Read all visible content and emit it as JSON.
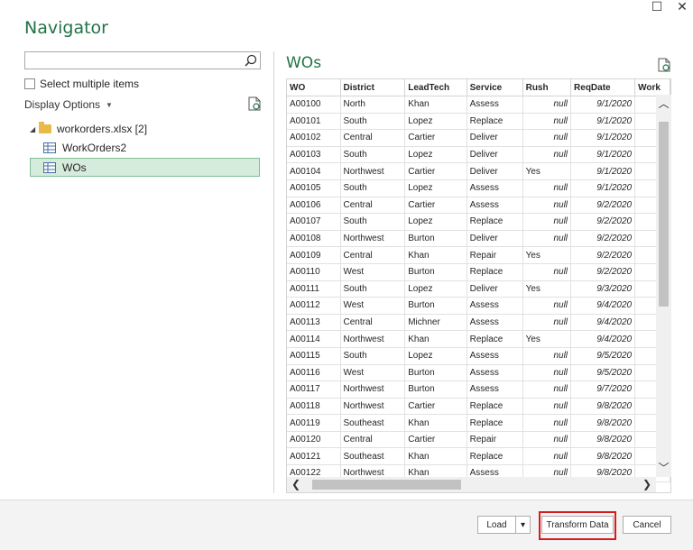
{
  "window": {
    "title": "Navigator",
    "maximize_glyph": "☐",
    "close_glyph": "✕"
  },
  "left": {
    "search": {
      "placeholder": "",
      "value": ""
    },
    "select_multiple_label": "Select multiple items",
    "display_options_label": "Display Options",
    "tree": {
      "file_label": "workorders.xlsx [2]",
      "items": [
        {
          "label": "WorkOrders2",
          "icon": "table-icon",
          "selected": false
        },
        {
          "label": "WOs",
          "icon": "table-icon",
          "selected": true
        }
      ]
    }
  },
  "preview": {
    "title": "WOs",
    "columns": [
      "WO",
      "District",
      "LeadTech",
      "Service",
      "Rush",
      "ReqDate",
      "Work"
    ],
    "rows": [
      [
        "A00100",
        "North",
        "Khan",
        "Assess",
        "null",
        "9/1/2020"
      ],
      [
        "A00101",
        "South",
        "Lopez",
        "Replace",
        "null",
        "9/1/2020"
      ],
      [
        "A00102",
        "Central",
        "Cartier",
        "Deliver",
        "null",
        "9/1/2020"
      ],
      [
        "A00103",
        "South",
        "Lopez",
        "Deliver",
        "null",
        "9/1/2020"
      ],
      [
        "A00104",
        "Northwest",
        "Cartier",
        "Deliver",
        "Yes",
        "9/1/2020"
      ],
      [
        "A00105",
        "South",
        "Lopez",
        "Assess",
        "null",
        "9/1/2020"
      ],
      [
        "A00106",
        "Central",
        "Cartier",
        "Assess",
        "null",
        "9/2/2020"
      ],
      [
        "A00107",
        "South",
        "Lopez",
        "Replace",
        "null",
        "9/2/2020"
      ],
      [
        "A00108",
        "Northwest",
        "Burton",
        "Deliver",
        "null",
        "9/2/2020"
      ],
      [
        "A00109",
        "Central",
        "Khan",
        "Repair",
        "Yes",
        "9/2/2020"
      ],
      [
        "A00110",
        "West",
        "Burton",
        "Replace",
        "null",
        "9/2/2020"
      ],
      [
        "A00111",
        "South",
        "Lopez",
        "Deliver",
        "Yes",
        "9/3/2020"
      ],
      [
        "A00112",
        "West",
        "Burton",
        "Assess",
        "null",
        "9/4/2020"
      ],
      [
        "A00113",
        "Central",
        "Michner",
        "Assess",
        "null",
        "9/4/2020"
      ],
      [
        "A00114",
        "Northwest",
        "Khan",
        "Replace",
        "Yes",
        "9/4/2020"
      ],
      [
        "A00115",
        "South",
        "Lopez",
        "Assess",
        "null",
        "9/5/2020"
      ],
      [
        "A00116",
        "West",
        "Burton",
        "Assess",
        "null",
        "9/5/2020"
      ],
      [
        "A00117",
        "Northwest",
        "Burton",
        "Assess",
        "null",
        "9/7/2020"
      ],
      [
        "A00118",
        "Northwest",
        "Cartier",
        "Replace",
        "null",
        "9/8/2020"
      ],
      [
        "A00119",
        "Southeast",
        "Khan",
        "Replace",
        "null",
        "9/8/2020"
      ],
      [
        "A00120",
        "Central",
        "Cartier",
        "Repair",
        "null",
        "9/8/2020"
      ],
      [
        "A00121",
        "Southeast",
        "Khan",
        "Replace",
        "null",
        "9/8/2020"
      ],
      [
        "A00122",
        "Northwest",
        "Khan",
        "Assess",
        "null",
        "9/8/2020"
      ]
    ]
  },
  "footer": {
    "load_label": "Load",
    "load_dropdown_glyph": "▾",
    "transform_label": "Transform Data",
    "cancel_label": "Cancel"
  },
  "colors": {
    "accent": "#217346",
    "selection_bg": "#d5ebdb",
    "highlight_border": "#d51c1c"
  }
}
